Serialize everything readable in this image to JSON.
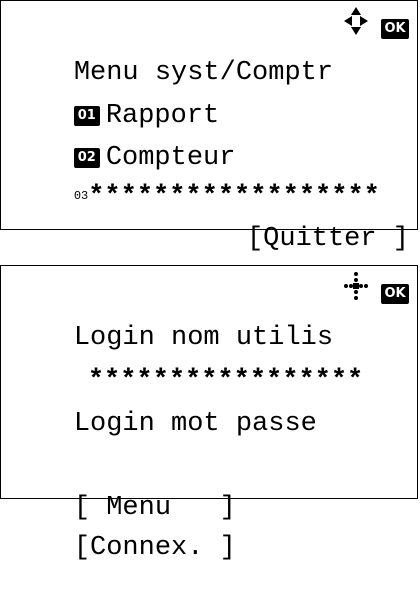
{
  "screen1": {
    "title": "Menu syst/Comptr",
    "ok_label": "OK",
    "items": [
      {
        "number": "01",
        "label": "Rapport"
      },
      {
        "number": "02",
        "label": "Compteur"
      }
    ],
    "lead_glyph": "03",
    "stars": "******************",
    "softkey": "[Quitter ]"
  },
  "screen2": {
    "field1_label": "Login nom utilis",
    "ok_label": "OK",
    "field1_value": "*****************",
    "field2_label": "Login mot passe",
    "field2_value": "",
    "softkeys": [
      "[ Menu   ]",
      "[Connex. ]"
    ]
  }
}
